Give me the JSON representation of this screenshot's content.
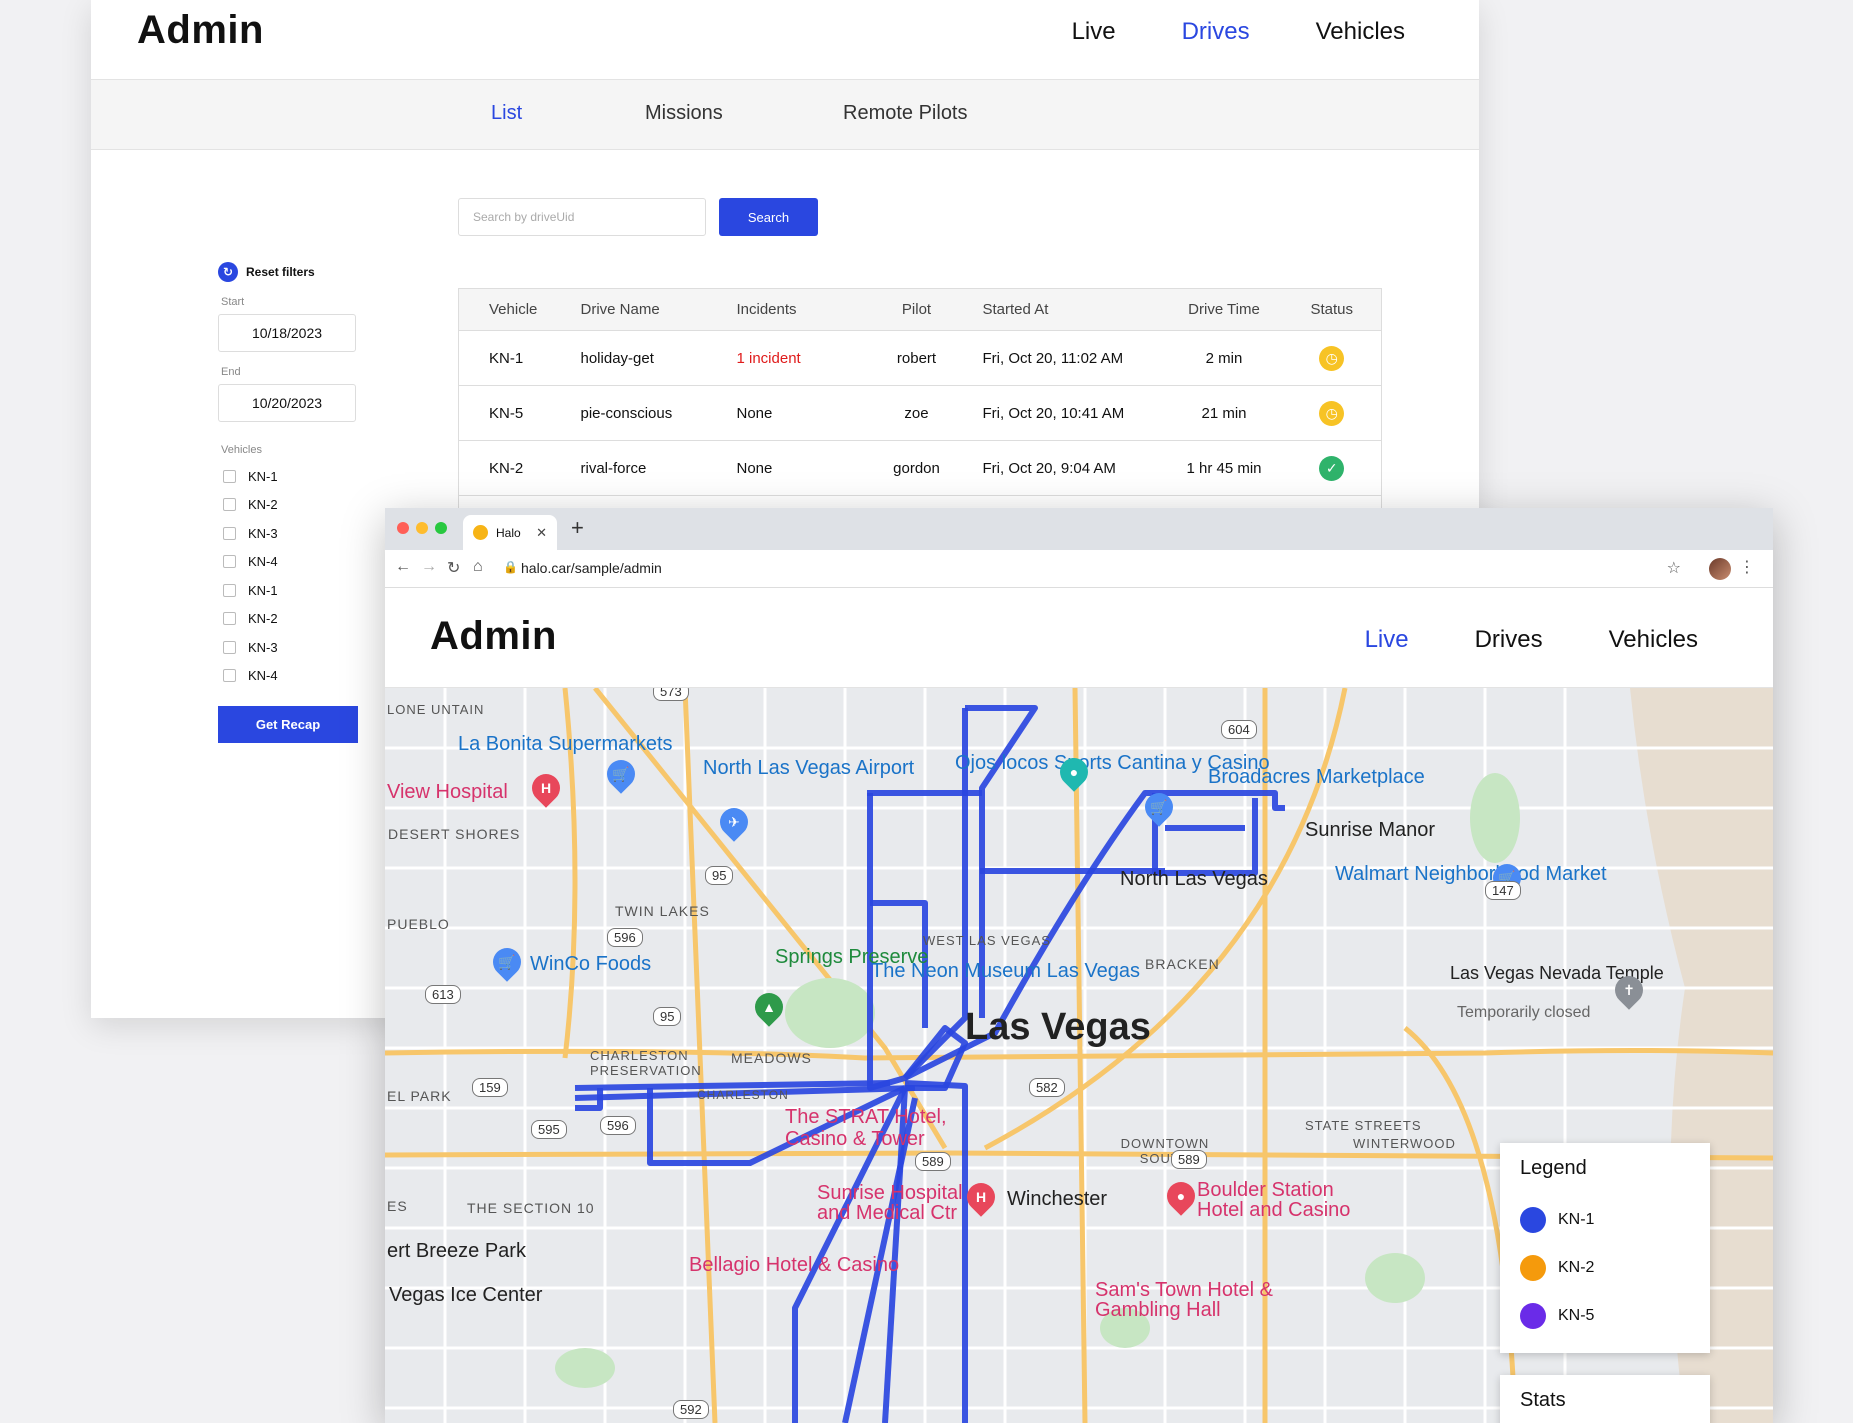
{
  "back": {
    "brand": "Admin",
    "nav": [
      "Live",
      "Drives",
      "Vehicles"
    ],
    "subnav": [
      "List",
      "Missions",
      "Remote Pilots"
    ],
    "search": {
      "placeholder": "Search by driveUid",
      "button": "Search"
    },
    "filters": {
      "reset": "Reset filters",
      "start_label": "Start",
      "start_value": "10/18/2023",
      "end_label": "End",
      "end_value": "10/20/2023",
      "vehicles_label": "Vehicles",
      "vehicles": [
        "KN-1",
        "KN-2",
        "KN-3",
        "KN-4",
        "KN-1",
        "KN-2",
        "KN-3",
        "KN-4"
      ],
      "recap_button": "Get Recap"
    },
    "table": {
      "headers": [
        "Vehicle",
        "Drive Name",
        "Incidents",
        "Pilot",
        "Started At",
        "Drive Time",
        "Status"
      ],
      "rows": [
        {
          "vehicle": "KN-1",
          "name": "holiday-get",
          "incidents": "1 incident",
          "pilot": "robert",
          "started": "Fri, Oct 20, 11:02 AM",
          "time": "2 min",
          "status": "clock-icon"
        },
        {
          "vehicle": "KN-5",
          "name": "pie-conscious",
          "incidents": "None",
          "pilot": "zoe",
          "started": "Fri, Oct 20, 10:41 AM",
          "time": "21 min",
          "status": "clock-icon"
        },
        {
          "vehicle": "KN-2",
          "name": "rival-force",
          "incidents": "None",
          "pilot": "gordon",
          "started": "Fri, Oct 20, 9:04 AM",
          "time": "1 hr 45 min",
          "status": "check-icon"
        }
      ]
    }
  },
  "browser": {
    "tab_title": "Halo",
    "url": "halo.car/sample/admin",
    "brand": "Admin",
    "nav": [
      "Live",
      "Drives",
      "Vehicles"
    ],
    "route_color": "#2a47e0",
    "map_labels": {
      "supermarket": "La Bonita Supermarkets",
      "airport": "North Las Vegas Airport",
      "sports": "Ojos locos Sports Cantina y Casino",
      "broadacres": "Broadacres Marketplace",
      "sunrise_manor": "Sunrise Manor",
      "view_hospital": "View Hospital",
      "desert_shores": "DESERT SHORES",
      "north_lv": "North Las Vegas",
      "walmart": "Walmart Neighborhood Market",
      "twin_lakes": "TWIN LAKES",
      "pueblo": "PUEBLO",
      "west_lv": "WEST LAS VEGAS",
      "bracken": "BRACKEN",
      "winco": "WinCo Foods",
      "springs": "Springs Preserve",
      "neon": "The Neon Museum Las Vegas",
      "temple": "Las Vegas Nevada Temple",
      "temple_closed": "Temporarily closed",
      "las_vegas": "Las Vegas",
      "charleston": "CHARLESTON PRESERVATION",
      "meadows": "MEADOWS",
      "el_park": "EL PARK",
      "strat": "The STRAT Hotel, Casino & Tower",
      "downtown_south": "DOWNTOWN SOUTH",
      "state_streets": "STATE STREETS",
      "winterwood": "WINTERWOOD",
      "section10": "THE SECTION 10",
      "sunrise_hospital": "Sunrise Hospital and Medical Ctr",
      "winchester": "Winchester",
      "boulder": "Boulder Station Hotel and Casino",
      "breeze": "ert Breeze Park",
      "bellagio": "Bellagio Hotel & Casino",
      "ice": "Vegas Ice Center",
      "sams": "Sam's Town Hotel & Gambling Hall",
      "lone": "LONE UNTAIN",
      "es": "ES",
      "charleston_st": "CHARLESTON"
    },
    "legend": {
      "title": "Legend",
      "items": [
        {
          "label": "KN-1",
          "color": "#2a47e0"
        },
        {
          "label": "KN-2",
          "color": "#f59a0c"
        },
        {
          "label": "KN-5",
          "color": "#6a2be8"
        }
      ]
    },
    "stats_title": "Stats"
  }
}
